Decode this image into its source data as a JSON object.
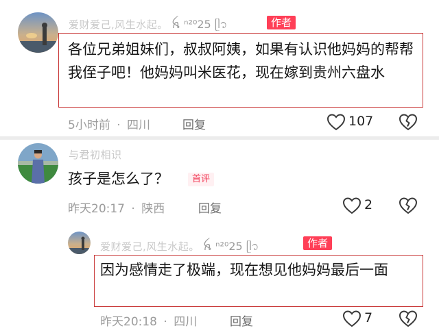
{
  "comment1": {
    "username": "爱财爱己,风生水起",
    "name_suffix": "。",
    "name_deco": "ꫝ ⁿ²⁰25 ᥫ᭡",
    "author_tag": "作者",
    "content": "各位兄弟姐妹们，叔叔阿姨，如果有认识他妈妈的帮帮我侄子吧！他妈妈叫米医花，现在嫁到贵州六盘水",
    "time": "5小时前",
    "location": "四川",
    "reply_label": "回复",
    "like_count": "107"
  },
  "comment2": {
    "username": "与君初相识",
    "first_tag": "首评",
    "content": "孩子是怎么了？",
    "time": "昨天20:17",
    "location": "陕西",
    "reply_label": "回复",
    "like_count": "2"
  },
  "reply1": {
    "username": "爱财爱己,风生水起",
    "name_suffix": "。",
    "name_deco": "ꫝ ⁿ²⁰25 ᥫ᭡",
    "author_tag": "作者",
    "content": "因为感情走了极端，现在想见他妈妈最后一面",
    "time": "昨天20:18",
    "location": "四川",
    "reply_label": "回复",
    "like_count": "7"
  },
  "separator": "·",
  "colors": {
    "author_tag": "#ff3f57",
    "first_tag": "#f2405b",
    "highlight_box": "#c93838"
  }
}
